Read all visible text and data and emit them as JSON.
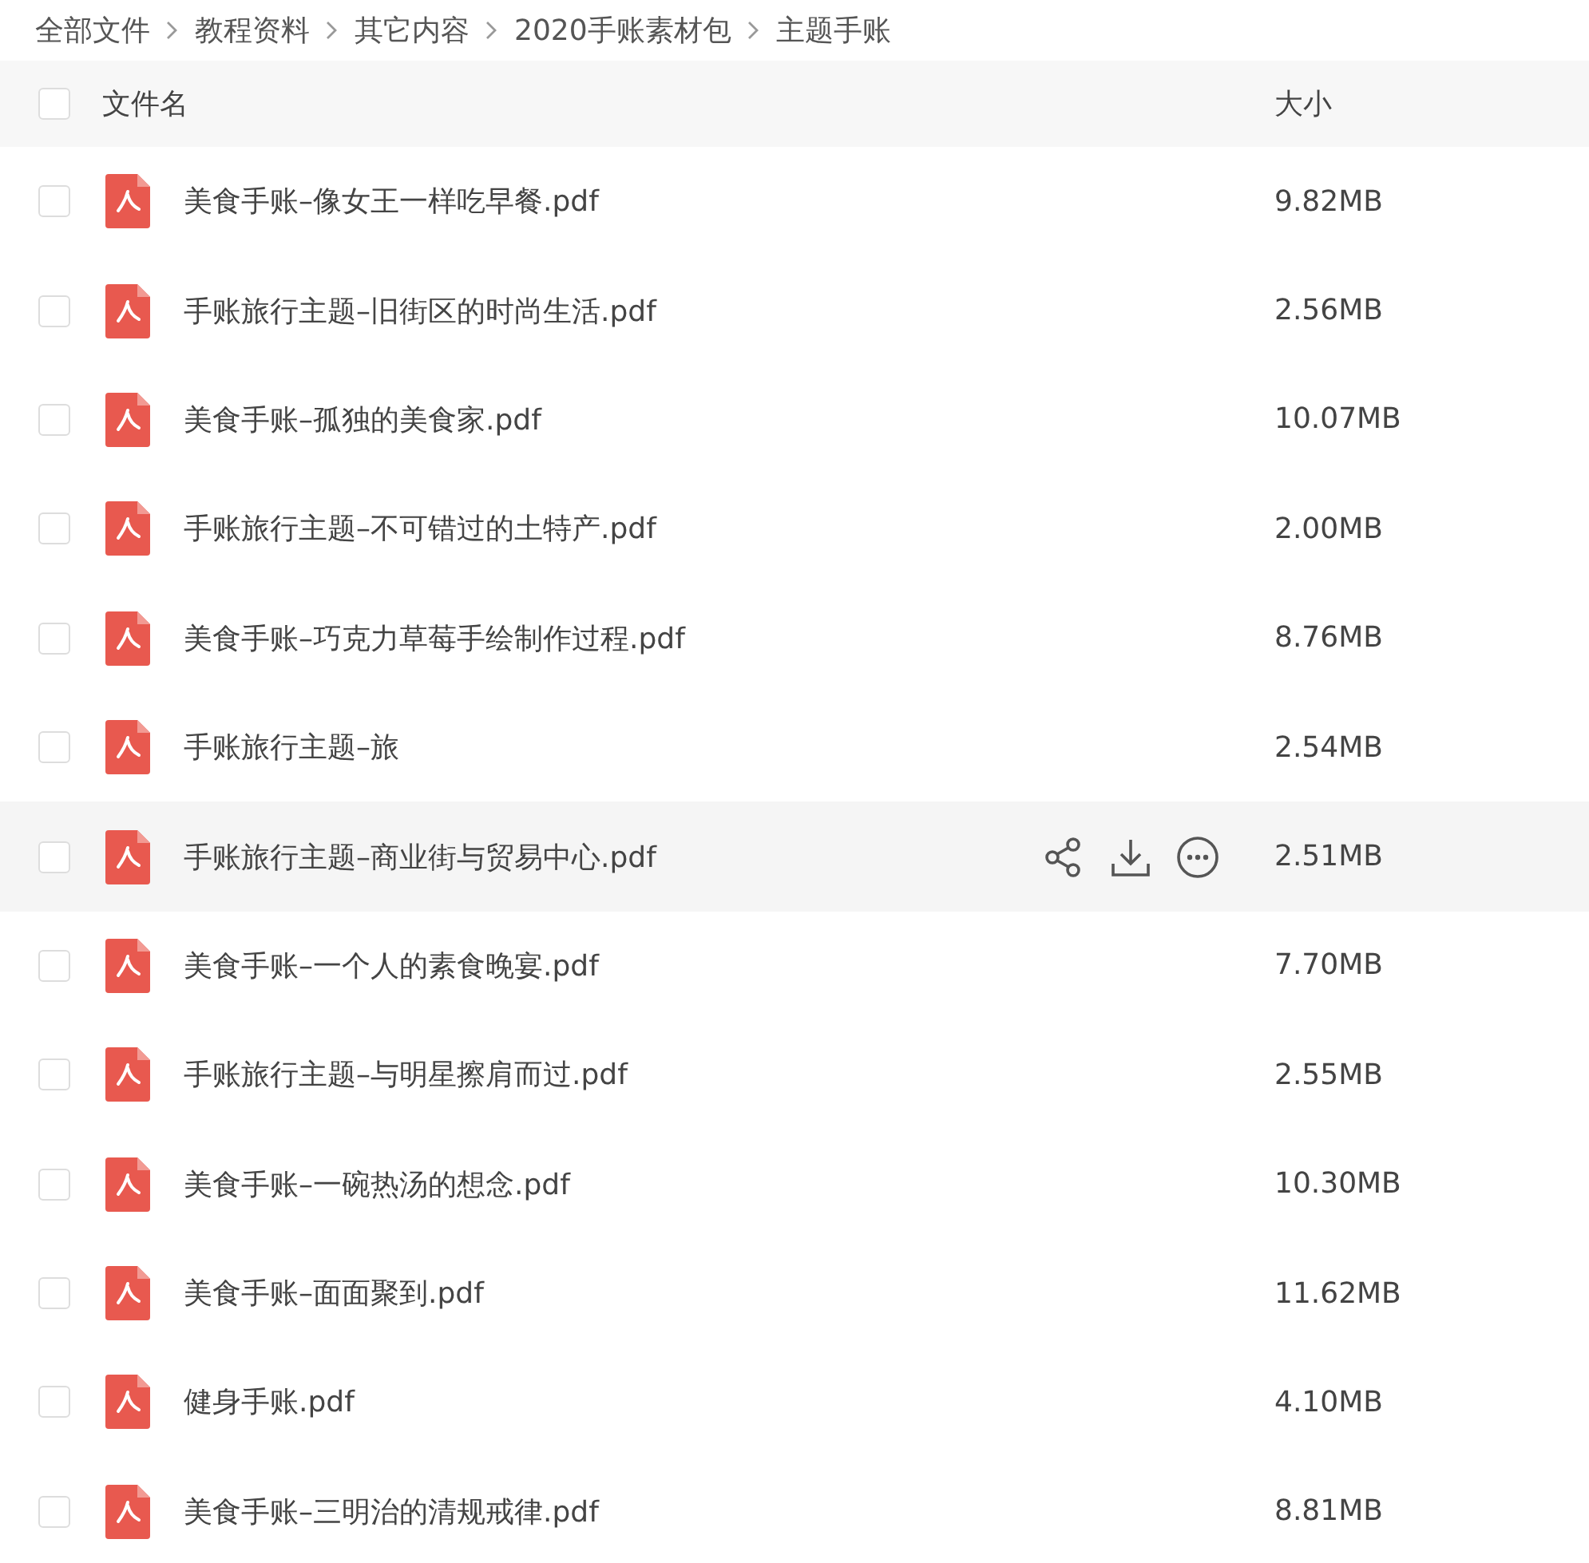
{
  "breadcrumb": [
    "全部文件",
    "教程资料",
    "其它内容",
    "2020手账素材包",
    "主题手账"
  ],
  "table": {
    "columns": [
      "文件名",
      "大小"
    ],
    "select_all": {
      "checked": false
    },
    "rows": [
      {
        "name": "美食手账–像女王一样吃早餐.pdf",
        "size": "9.82MB",
        "checked": false,
        "hovered": false
      },
      {
        "name": "手账旅行主题–旧街区的时尚生活.pdf",
        "size": "2.56MB",
        "checked": false,
        "hovered": false
      },
      {
        "name": "美食手账–孤独的美食家.pdf",
        "size": "10.07MB",
        "checked": false,
        "hovered": false
      },
      {
        "name": "手账旅行主题–不可错过的土特产.pdf",
        "size": "2.00MB",
        "checked": false,
        "hovered": false
      },
      {
        "name": "美食手账–巧克力草莓手绘制作过程.pdf",
        "size": "8.76MB",
        "checked": false,
        "hovered": false
      },
      {
        "name": "手账旅行主题–旅",
        "size": "2.54MB",
        "checked": false,
        "hovered": false
      },
      {
        "name": "手账旅行主题–商业街与贸易中心.pdf",
        "size": "2.51MB",
        "checked": false,
        "hovered": true
      },
      {
        "name": "美食手账–一个人的素食晚宴.pdf",
        "size": "7.70MB",
        "checked": false,
        "hovered": false
      },
      {
        "name": "手账旅行主题–与明星擦肩而过.pdf",
        "size": "2.55MB",
        "checked": false,
        "hovered": false
      },
      {
        "name": "美食手账–一碗热汤的想念.pdf",
        "size": "10.30MB",
        "checked": false,
        "hovered": false
      },
      {
        "name": "美食手账–面面聚到.pdf",
        "size": "11.62MB",
        "checked": false,
        "hovered": false
      },
      {
        "name": "健身手账.pdf",
        "size": "4.10MB",
        "checked": false,
        "hovered": false
      },
      {
        "name": "美食手账–三明治的清规戒律.pdf",
        "size": "8.81MB",
        "checked": false,
        "hovered": false
      }
    ]
  }
}
